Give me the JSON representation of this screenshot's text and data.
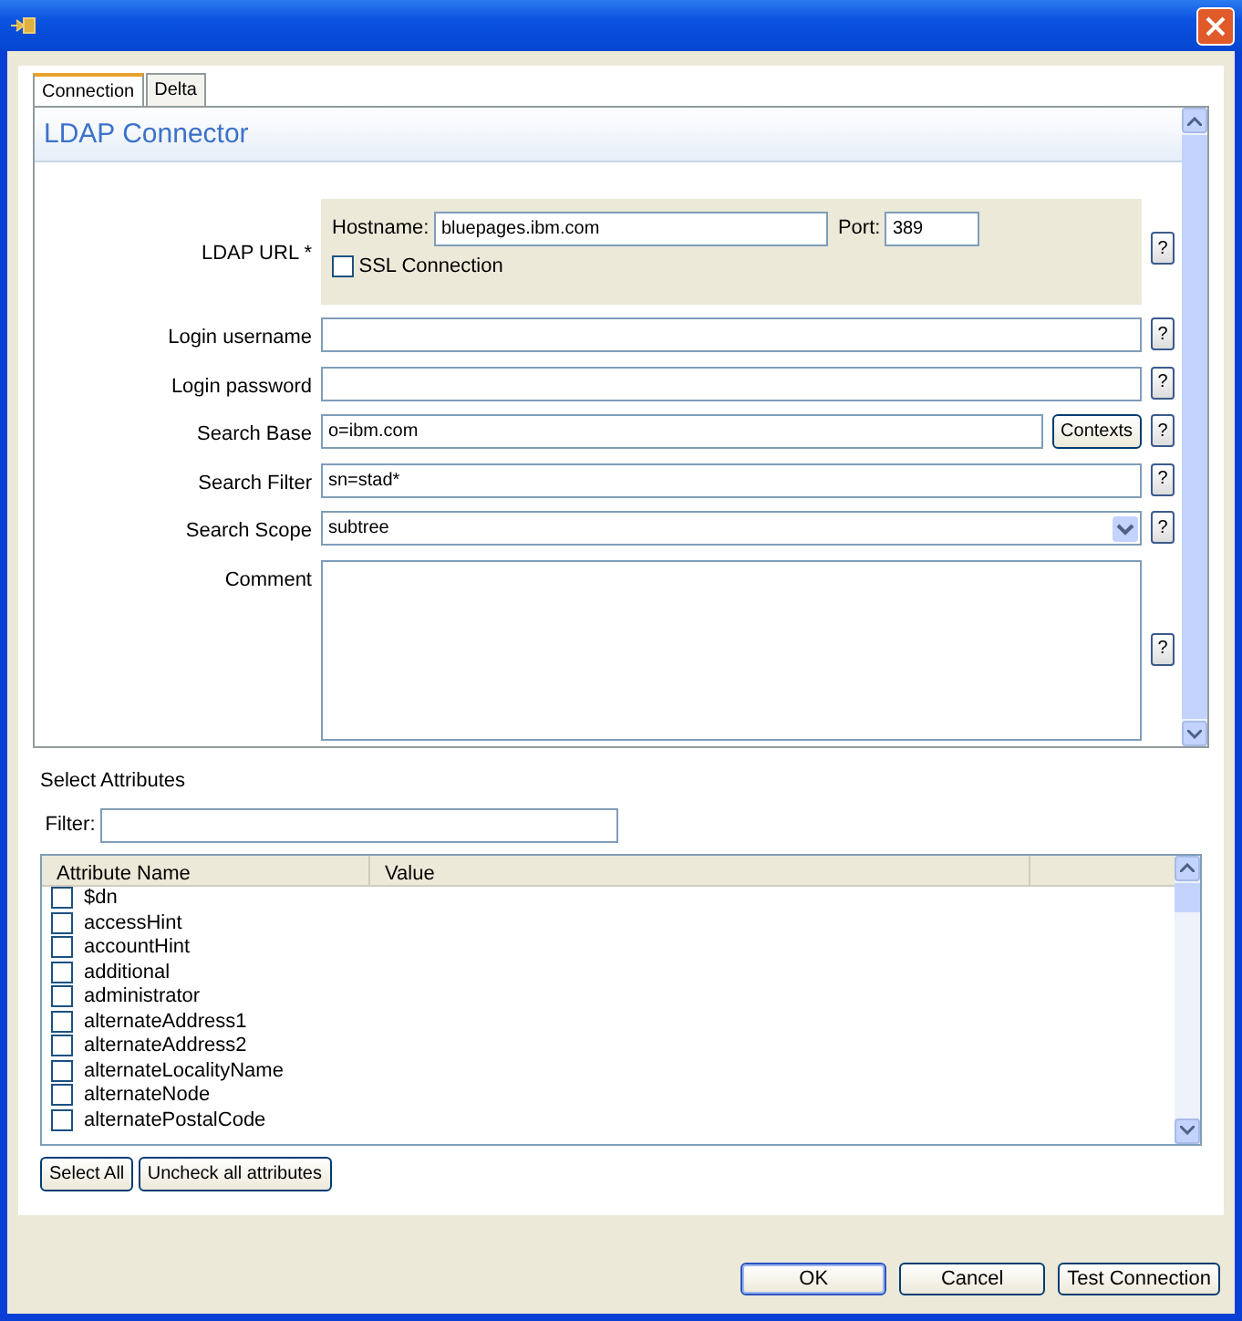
{
  "tabs": [
    {
      "label": "Connection",
      "selected": true
    },
    {
      "label": "Delta",
      "selected": false
    }
  ],
  "header": "LDAP Connector",
  "ldap_url": {
    "label": "LDAP URL *",
    "hostname_label": "Hostname:",
    "hostname": "bluepages.ibm.com",
    "port_label": "Port:",
    "port": "389",
    "ssl": {
      "label": "SSL Connection",
      "checked": false
    },
    "help": "?"
  },
  "fields": [
    {
      "kind": "text",
      "label": "Login username",
      "help": "?"
    },
    {
      "kind": "text",
      "label": "Login password",
      "help": "?"
    },
    {
      "kind": "text_button",
      "label": "Search Base",
      "value": "o=ibm.com",
      "button": "Contexts",
      "help": "?"
    },
    {
      "kind": "text",
      "label": "Search Filter",
      "value": "sn=stad*",
      "help": "?"
    },
    {
      "kind": "select",
      "label": "Search Scope",
      "value": "subtree",
      "help": "?"
    },
    {
      "kind": "textarea",
      "label": "Comment",
      "help": "?"
    }
  ],
  "attributes": {
    "title": "Select Attributes",
    "filter_label": "Filter:",
    "columns": [
      "Attribute Name",
      "Value"
    ],
    "rows": [
      {
        "name": "$dn",
        "checked": false
      },
      {
        "name": "accessHint",
        "checked": false
      },
      {
        "name": "accountHint",
        "checked": false
      },
      {
        "name": "additional",
        "checked": false
      },
      {
        "name": "administrator",
        "checked": false
      },
      {
        "name": "alternateAddress1",
        "checked": false
      },
      {
        "name": "alternateAddress2",
        "checked": false
      },
      {
        "name": "alternateLocalityName",
        "checked": false
      },
      {
        "name": "alternateNode",
        "checked": false
      },
      {
        "name": "alternatePostalCode",
        "checked": false
      }
    ],
    "buttons": [
      "Select All",
      "Uncheck all attributes"
    ]
  },
  "dialog_buttons": [
    {
      "label": "OK",
      "default": true
    },
    {
      "label": "Cancel",
      "default": false
    },
    {
      "label": "Test Connection",
      "default": false
    }
  ]
}
